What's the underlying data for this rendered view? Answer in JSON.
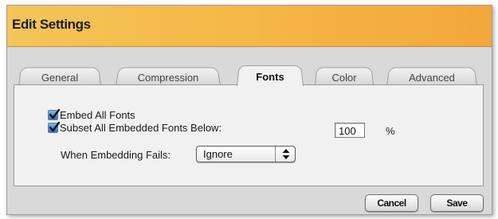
{
  "window": {
    "title": "Edit Settings"
  },
  "tabs": [
    {
      "label": "General"
    },
    {
      "label": "Compression"
    },
    {
      "label": "Fonts"
    },
    {
      "label": "Color"
    },
    {
      "label": "Advanced"
    }
  ],
  "active_tab": "Fonts",
  "fonts_panel": {
    "embed_all": {
      "label": "Embed All Fonts",
      "checked": true
    },
    "subset": {
      "label": "Subset All Embedded Fonts Below:",
      "checked": true,
      "value": "100",
      "unit": "%"
    },
    "embed_fail": {
      "label": "When Embedding Fails:",
      "selected": "Ignore"
    }
  },
  "buttons": {
    "cancel": "Cancel",
    "save": "Save"
  },
  "colors": {
    "accent_checkbox": "#2f73c7",
    "titlebar_orange": "#f5b948"
  }
}
